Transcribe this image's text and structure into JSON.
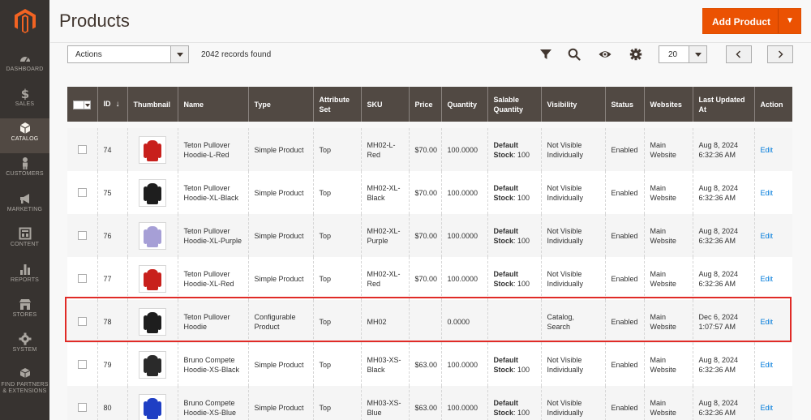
{
  "sidebar": {
    "items": [
      {
        "label": "DASHBOARD",
        "icon": "dashboard-icon"
      },
      {
        "label": "SALES",
        "icon": "dollar-icon"
      },
      {
        "label": "CATALOG",
        "icon": "cube-icon",
        "active": true
      },
      {
        "label": "CUSTOMERS",
        "icon": "person-icon"
      },
      {
        "label": "MARKETING",
        "icon": "megaphone-icon"
      },
      {
        "label": "CONTENT",
        "icon": "layout-icon"
      },
      {
        "label": "REPORTS",
        "icon": "bar-chart-icon"
      },
      {
        "label": "STORES",
        "icon": "store-icon"
      },
      {
        "label": "SYSTEM",
        "icon": "gear-icon"
      },
      {
        "label": "FIND PARTNERS",
        "label2": "& EXTENSIONS",
        "icon": "boxes-icon"
      }
    ]
  },
  "header": {
    "title": "Products",
    "add_button": "Add Product"
  },
  "toolbar": {
    "actions_label": "Actions",
    "records_found": "2042 records found",
    "page_size": "20"
  },
  "grid": {
    "columns": [
      "ID",
      "Thumbnail",
      "Name",
      "Type",
      "Attribute Set",
      "SKU",
      "Price",
      "Quantity",
      "Salable Quantity",
      "Visibility",
      "Status",
      "Websites",
      "Last Updated At",
      "Action"
    ],
    "rows": [
      {
        "id": "74",
        "name": "Teton Pullover Hoodie-L-Red",
        "type": "Simple Product",
        "attr": "Top",
        "sku": "MH02-L-Red",
        "price": "$70.00",
        "qty": "100.0000",
        "stock_label": "Default Stock",
        "stock_qty": ": 100",
        "visibility": "Not Visible Individually",
        "status": "Enabled",
        "websites": "Main Website",
        "updated": "Aug 8, 2024 6:32:36 AM",
        "action": "Edit",
        "color": "#c8201c"
      },
      {
        "id": "75",
        "name": "Teton Pullover Hoodie-XL-Black",
        "type": "Simple Product",
        "attr": "Top",
        "sku": "MH02-XL-Black",
        "price": "$70.00",
        "qty": "100.0000",
        "stock_label": "Default Stock",
        "stock_qty": ": 100",
        "visibility": "Not Visible Individually",
        "status": "Enabled",
        "websites": "Main Website",
        "updated": "Aug 8, 2024 6:32:36 AM",
        "action": "Edit",
        "color": "#1e1e1e"
      },
      {
        "id": "76",
        "name": "Teton Pullover Hoodie-XL-Purple",
        "type": "Simple Product",
        "attr": "Top",
        "sku": "MH02-XL-Purple",
        "price": "$70.00",
        "qty": "100.0000",
        "stock_label": "Default Stock",
        "stock_qty": ": 100",
        "visibility": "Not Visible Individually",
        "status": "Enabled",
        "websites": "Main Website",
        "updated": "Aug 8, 2024 6:32:36 AM",
        "action": "Edit",
        "color": "#a69fd6"
      },
      {
        "id": "77",
        "name": "Teton Pullover Hoodie-XL-Red",
        "type": "Simple Product",
        "attr": "Top",
        "sku": "MH02-XL-Red",
        "price": "$70.00",
        "qty": "100.0000",
        "stock_label": "Default Stock",
        "stock_qty": ": 100",
        "visibility": "Not Visible Individually",
        "status": "Enabled",
        "websites": "Main Website",
        "updated": "Aug 8, 2024 6:32:36 AM",
        "action": "Edit",
        "color": "#c8201c"
      },
      {
        "id": "78",
        "name": "Teton Pullover Hoodie",
        "type": "Configurable Product",
        "attr": "Top",
        "sku": "MH02",
        "price": "",
        "qty": "0.0000",
        "stock_label": "",
        "stock_qty": "",
        "visibility": "Catalog, Search",
        "status": "Enabled",
        "websites": "Main Website",
        "updated": "Dec 6, 2024 1:07:57 AM",
        "action": "Edit",
        "color": "#1e1e1e"
      },
      {
        "id": "79",
        "name": "Bruno Compete Hoodie-XS-Black",
        "type": "Simple Product",
        "attr": "Top",
        "sku": "MH03-XS-Black",
        "price": "$63.00",
        "qty": "100.0000",
        "stock_label": "Default Stock",
        "stock_qty": ": 100",
        "visibility": "Not Visible Individually",
        "status": "Enabled",
        "websites": "Main Website",
        "updated": "Aug 8, 2024 6:32:36 AM",
        "action": "Edit",
        "color": "#2a2a2a"
      },
      {
        "id": "80",
        "name": "Bruno Compete Hoodie-XS-Blue",
        "type": "Simple Product",
        "attr": "Top",
        "sku": "MH03-XS-Blue",
        "price": "$63.00",
        "qty": "100.0000",
        "stock_label": "Default Stock",
        "stock_qty": ": 100",
        "visibility": "Not Visible Individually",
        "status": "Enabled",
        "websites": "Main Website",
        "updated": "Aug 8, 2024 6:32:36 AM",
        "action": "Edit",
        "color": "#1f3fc4"
      }
    ]
  },
  "colors": {
    "accent": "#eb5202",
    "sidebar": "#373330",
    "header_row": "#514943",
    "highlight": "#e02b27"
  }
}
